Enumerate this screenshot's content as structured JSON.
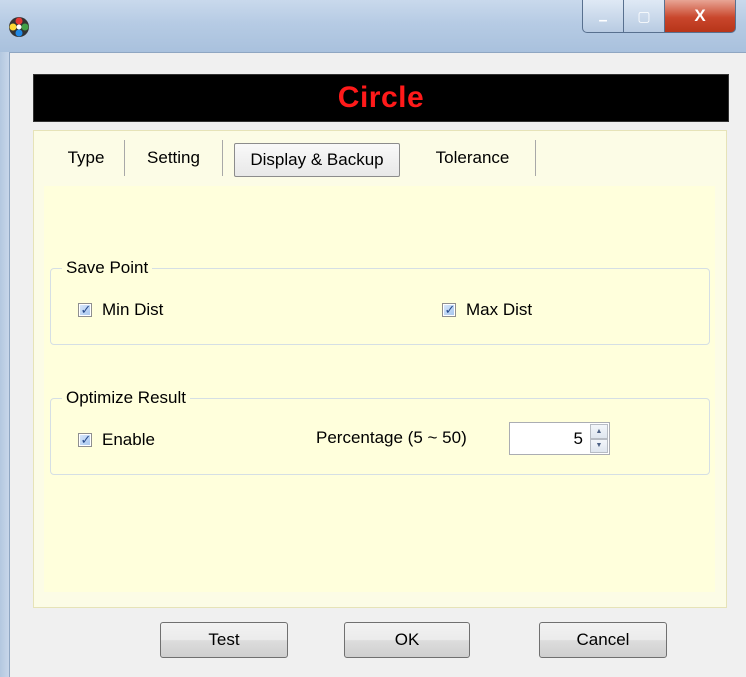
{
  "window": {
    "icon": "colorful-app-icon",
    "controls": {
      "minimize": "▁",
      "maximize": "▢",
      "close": "X"
    }
  },
  "banner": {
    "title": "Circle",
    "title_color": "#ff1a1a"
  },
  "tabs": [
    {
      "label": "Type",
      "active": false
    },
    {
      "label": "Setting",
      "active": false
    },
    {
      "label": "Display & Backup",
      "active": true
    },
    {
      "label": "Tolerance",
      "active": false
    }
  ],
  "save_point": {
    "title": "Save Point",
    "min_dist": {
      "label": "Min Dist",
      "checked": true
    },
    "max_dist": {
      "label": "Max Dist",
      "checked": true
    }
  },
  "optimize_result": {
    "title": "Optimize Result",
    "enable": {
      "label": "Enable",
      "checked": true
    },
    "percentage_label": "Percentage (5 ~ 50)",
    "percentage_value": "5",
    "spin_up": "▲",
    "spin_down": "▼"
  },
  "buttons": {
    "test": "Test",
    "ok": "OK",
    "cancel": "Cancel"
  },
  "check_mark": "✓"
}
